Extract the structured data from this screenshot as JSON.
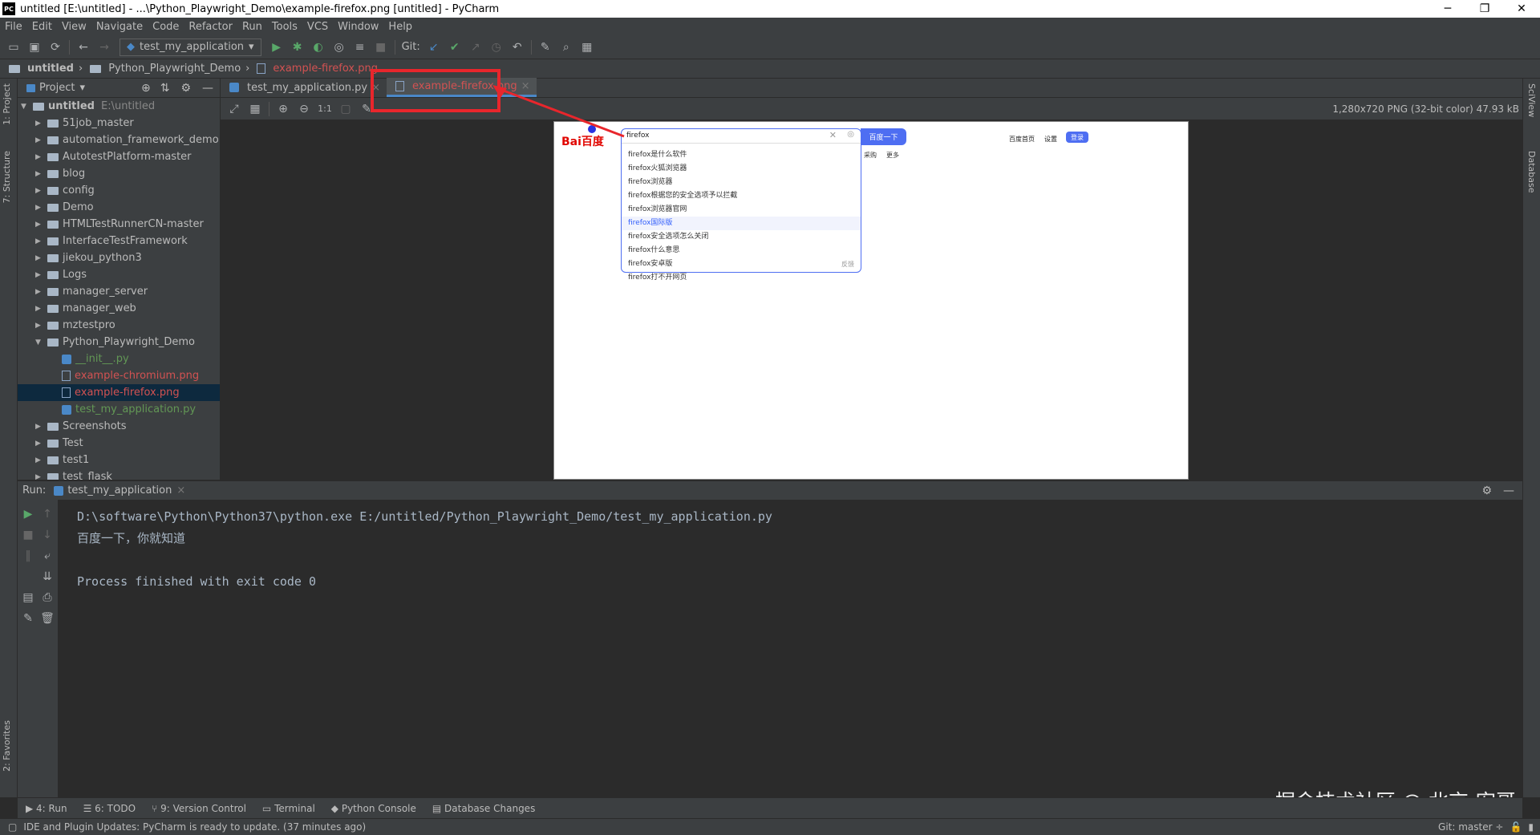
{
  "window": {
    "title": "untitled [E:\\untitled] - ...\\Python_Playwright_Demo\\example-firefox.png [untitled] - PyCharm",
    "app_icon": "PC",
    "controls": [
      "─",
      "❐",
      "✕"
    ]
  },
  "menu": [
    "File",
    "Edit",
    "View",
    "Navigate",
    "Code",
    "Refactor",
    "Run",
    "Tools",
    "VCS",
    "Window",
    "Help"
  ],
  "toolbar": {
    "run_config": "test_my_application",
    "git_label": "Git:"
  },
  "breadcrumb": [
    "untitled",
    "Python_Playwright_Demo",
    "example-firefox.png"
  ],
  "left_tabs": {
    "project": "1: Project",
    "structure": "7: Structure",
    "favorites": "2: Favorites"
  },
  "right_tabs": {
    "sciview": "SciView",
    "database": "Database"
  },
  "project": {
    "header": "Project",
    "root": "untitled",
    "root_path": "E:\\untitled",
    "items": [
      {
        "label": "51job_master",
        "kind": "folder",
        "depth": 1
      },
      {
        "label": "automation_framework_demo",
        "kind": "folder",
        "depth": 1
      },
      {
        "label": "AutotestPlatform-master",
        "kind": "folder",
        "depth": 1
      },
      {
        "label": "blog",
        "kind": "folder",
        "depth": 1
      },
      {
        "label": "config",
        "kind": "folder",
        "depth": 1
      },
      {
        "label": "Demo",
        "kind": "folder",
        "depth": 1
      },
      {
        "label": "HTMLTestRunnerCN-master",
        "kind": "folder",
        "depth": 1
      },
      {
        "label": "InterfaceTestFramework",
        "kind": "folder",
        "depth": 1
      },
      {
        "label": "jiekou_python3",
        "kind": "folder",
        "depth": 1
      },
      {
        "label": "Logs",
        "kind": "folder",
        "depth": 1
      },
      {
        "label": "manager_server",
        "kind": "folder",
        "depth": 1
      },
      {
        "label": "manager_web",
        "kind": "folder",
        "depth": 1
      },
      {
        "label": "mztestpro",
        "kind": "folder",
        "depth": 1
      },
      {
        "label": "Python_Playwright_Demo",
        "kind": "folder-open",
        "depth": 1
      },
      {
        "label": "__init__.py",
        "kind": "py",
        "depth": 2,
        "color": "#629755"
      },
      {
        "label": "example-chromium.png",
        "kind": "img",
        "depth": 2,
        "color": "#d25252"
      },
      {
        "label": "example-firefox.png",
        "kind": "img",
        "depth": 2,
        "color": "#d25252",
        "selected": true
      },
      {
        "label": "test_my_application.py",
        "kind": "py",
        "depth": 2,
        "color": "#629755"
      },
      {
        "label": "Screenshots",
        "kind": "folder",
        "depth": 1
      },
      {
        "label": "Test",
        "kind": "folder",
        "depth": 1
      },
      {
        "label": "test1",
        "kind": "folder",
        "depth": 1
      },
      {
        "label": "test_flask",
        "kind": "folder",
        "depth": 1
      }
    ]
  },
  "editor_tabs": [
    {
      "label": "test_my_application.py",
      "active": false,
      "color": "#a9b7c6"
    },
    {
      "label": "example-firefox.png",
      "active": true,
      "color": "#d25252"
    }
  ],
  "image_viewer": {
    "zoom_label": "1:1",
    "info": "1,280x720 PNG (32-bit color) 47.93 kB"
  },
  "screenshot_content": {
    "logo": "Bai百度",
    "search_value": "firefox",
    "search_button": "百度一下",
    "suggestions": [
      "firefox是什么软件",
      "firefox火狐浏览器",
      "firefox浏览器",
      "firefox根据您的安全选项予以拦截",
      "firefox浏览器官网",
      "firefox国际版",
      "firefox安全选项怎么关闭",
      "firefox什么意思",
      "firefox安卓版",
      "firefox打不开网页"
    ],
    "highlight_index": 5,
    "feedback": "反馈",
    "top_links": [
      "百度首页",
      "设置",
      "登录"
    ],
    "side_links": [
      "采购",
      "更多"
    ]
  },
  "run": {
    "label": "Run:",
    "tab": "test_my_application",
    "lines": [
      "D:\\software\\Python\\Python37\\python.exe E:/untitled/Python_Playwright_Demo/test_my_application.py",
      "百度一下，你就知道",
      "",
      "Process finished with exit code 0"
    ]
  },
  "bottom_tabs": [
    "4: Run",
    "6: TODO",
    "9: Version Control",
    "Terminal",
    "Python Console",
    "Database Changes"
  ],
  "status": {
    "message": "IDE and Plugin Updates: PyCharm is ready to update. (37 minutes ago)",
    "git": "Git: master ÷"
  },
  "watermark": "掘金技术社区 @ 北京-宏哥",
  "colors": {
    "highlight_box": "#e8262c",
    "arrow": "#e8262c",
    "baidu_blue": "#4e6ef2"
  }
}
